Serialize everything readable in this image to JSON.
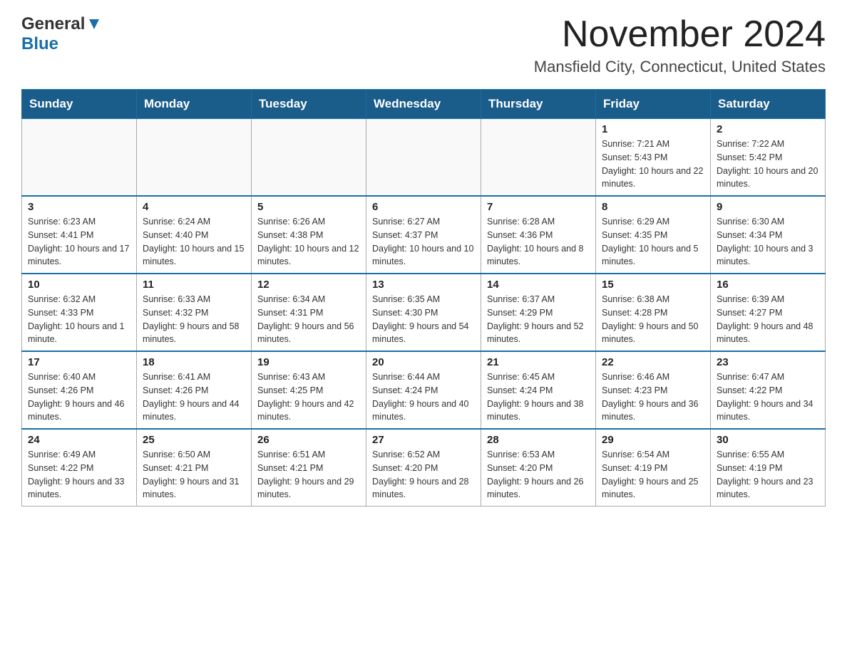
{
  "logo": {
    "general": "General",
    "blue": "Blue"
  },
  "title": {
    "month_year": "November 2024",
    "location": "Mansfield City, Connecticut, United States"
  },
  "headers": [
    "Sunday",
    "Monday",
    "Tuesday",
    "Wednesday",
    "Thursday",
    "Friday",
    "Saturday"
  ],
  "weeks": [
    [
      {
        "day": "",
        "sunrise": "",
        "sunset": "",
        "daylight": ""
      },
      {
        "day": "",
        "sunrise": "",
        "sunset": "",
        "daylight": ""
      },
      {
        "day": "",
        "sunrise": "",
        "sunset": "",
        "daylight": ""
      },
      {
        "day": "",
        "sunrise": "",
        "sunset": "",
        "daylight": ""
      },
      {
        "day": "",
        "sunrise": "",
        "sunset": "",
        "daylight": ""
      },
      {
        "day": "1",
        "sunrise": "Sunrise: 7:21 AM",
        "sunset": "Sunset: 5:43 PM",
        "daylight": "Daylight: 10 hours and 22 minutes."
      },
      {
        "day": "2",
        "sunrise": "Sunrise: 7:22 AM",
        "sunset": "Sunset: 5:42 PM",
        "daylight": "Daylight: 10 hours and 20 minutes."
      }
    ],
    [
      {
        "day": "3",
        "sunrise": "Sunrise: 6:23 AM",
        "sunset": "Sunset: 4:41 PM",
        "daylight": "Daylight: 10 hours and 17 minutes."
      },
      {
        "day": "4",
        "sunrise": "Sunrise: 6:24 AM",
        "sunset": "Sunset: 4:40 PM",
        "daylight": "Daylight: 10 hours and 15 minutes."
      },
      {
        "day": "5",
        "sunrise": "Sunrise: 6:26 AM",
        "sunset": "Sunset: 4:38 PM",
        "daylight": "Daylight: 10 hours and 12 minutes."
      },
      {
        "day": "6",
        "sunrise": "Sunrise: 6:27 AM",
        "sunset": "Sunset: 4:37 PM",
        "daylight": "Daylight: 10 hours and 10 minutes."
      },
      {
        "day": "7",
        "sunrise": "Sunrise: 6:28 AM",
        "sunset": "Sunset: 4:36 PM",
        "daylight": "Daylight: 10 hours and 8 minutes."
      },
      {
        "day": "8",
        "sunrise": "Sunrise: 6:29 AM",
        "sunset": "Sunset: 4:35 PM",
        "daylight": "Daylight: 10 hours and 5 minutes."
      },
      {
        "day": "9",
        "sunrise": "Sunrise: 6:30 AM",
        "sunset": "Sunset: 4:34 PM",
        "daylight": "Daylight: 10 hours and 3 minutes."
      }
    ],
    [
      {
        "day": "10",
        "sunrise": "Sunrise: 6:32 AM",
        "sunset": "Sunset: 4:33 PM",
        "daylight": "Daylight: 10 hours and 1 minute."
      },
      {
        "day": "11",
        "sunrise": "Sunrise: 6:33 AM",
        "sunset": "Sunset: 4:32 PM",
        "daylight": "Daylight: 9 hours and 58 minutes."
      },
      {
        "day": "12",
        "sunrise": "Sunrise: 6:34 AM",
        "sunset": "Sunset: 4:31 PM",
        "daylight": "Daylight: 9 hours and 56 minutes."
      },
      {
        "day": "13",
        "sunrise": "Sunrise: 6:35 AM",
        "sunset": "Sunset: 4:30 PM",
        "daylight": "Daylight: 9 hours and 54 minutes."
      },
      {
        "day": "14",
        "sunrise": "Sunrise: 6:37 AM",
        "sunset": "Sunset: 4:29 PM",
        "daylight": "Daylight: 9 hours and 52 minutes."
      },
      {
        "day": "15",
        "sunrise": "Sunrise: 6:38 AM",
        "sunset": "Sunset: 4:28 PM",
        "daylight": "Daylight: 9 hours and 50 minutes."
      },
      {
        "day": "16",
        "sunrise": "Sunrise: 6:39 AM",
        "sunset": "Sunset: 4:27 PM",
        "daylight": "Daylight: 9 hours and 48 minutes."
      }
    ],
    [
      {
        "day": "17",
        "sunrise": "Sunrise: 6:40 AM",
        "sunset": "Sunset: 4:26 PM",
        "daylight": "Daylight: 9 hours and 46 minutes."
      },
      {
        "day": "18",
        "sunrise": "Sunrise: 6:41 AM",
        "sunset": "Sunset: 4:26 PM",
        "daylight": "Daylight: 9 hours and 44 minutes."
      },
      {
        "day": "19",
        "sunrise": "Sunrise: 6:43 AM",
        "sunset": "Sunset: 4:25 PM",
        "daylight": "Daylight: 9 hours and 42 minutes."
      },
      {
        "day": "20",
        "sunrise": "Sunrise: 6:44 AM",
        "sunset": "Sunset: 4:24 PM",
        "daylight": "Daylight: 9 hours and 40 minutes."
      },
      {
        "day": "21",
        "sunrise": "Sunrise: 6:45 AM",
        "sunset": "Sunset: 4:24 PM",
        "daylight": "Daylight: 9 hours and 38 minutes."
      },
      {
        "day": "22",
        "sunrise": "Sunrise: 6:46 AM",
        "sunset": "Sunset: 4:23 PM",
        "daylight": "Daylight: 9 hours and 36 minutes."
      },
      {
        "day": "23",
        "sunrise": "Sunrise: 6:47 AM",
        "sunset": "Sunset: 4:22 PM",
        "daylight": "Daylight: 9 hours and 34 minutes."
      }
    ],
    [
      {
        "day": "24",
        "sunrise": "Sunrise: 6:49 AM",
        "sunset": "Sunset: 4:22 PM",
        "daylight": "Daylight: 9 hours and 33 minutes."
      },
      {
        "day": "25",
        "sunrise": "Sunrise: 6:50 AM",
        "sunset": "Sunset: 4:21 PM",
        "daylight": "Daylight: 9 hours and 31 minutes."
      },
      {
        "day": "26",
        "sunrise": "Sunrise: 6:51 AM",
        "sunset": "Sunset: 4:21 PM",
        "daylight": "Daylight: 9 hours and 29 minutes."
      },
      {
        "day": "27",
        "sunrise": "Sunrise: 6:52 AM",
        "sunset": "Sunset: 4:20 PM",
        "daylight": "Daylight: 9 hours and 28 minutes."
      },
      {
        "day": "28",
        "sunrise": "Sunrise: 6:53 AM",
        "sunset": "Sunset: 4:20 PM",
        "daylight": "Daylight: 9 hours and 26 minutes."
      },
      {
        "day": "29",
        "sunrise": "Sunrise: 6:54 AM",
        "sunset": "Sunset: 4:19 PM",
        "daylight": "Daylight: 9 hours and 25 minutes."
      },
      {
        "day": "30",
        "sunrise": "Sunrise: 6:55 AM",
        "sunset": "Sunset: 4:19 PM",
        "daylight": "Daylight: 9 hours and 23 minutes."
      }
    ]
  ]
}
